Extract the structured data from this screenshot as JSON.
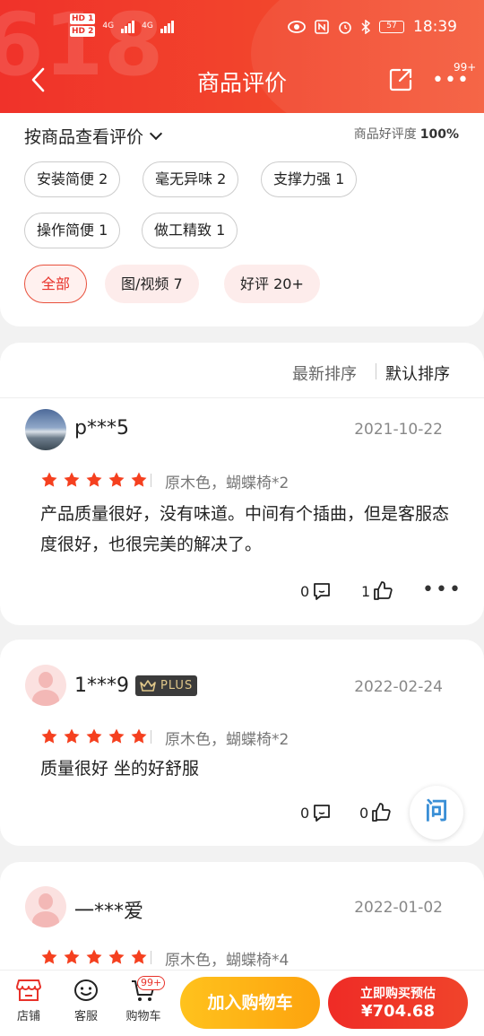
{
  "status_bar": {
    "sim1": "HD 1",
    "sim2": "HD 2",
    "net1": "4G",
    "net2": "4G",
    "battery": "57",
    "time": "18:39"
  },
  "header": {
    "background_text": "618",
    "title": "商品评价",
    "more_badge": "99+",
    "colors": {
      "primary": "#f0322a",
      "accent": "#f55b3a"
    }
  },
  "filters": {
    "by_product_label": "按商品查看评价",
    "good_rate_label": "商品好评度",
    "good_rate_value": "100%",
    "tags": [
      "安装简便 2",
      "毫无异味 2",
      "支撑力强 1",
      "操作简便 1",
      "做工精致 1"
    ],
    "categories": [
      {
        "label": "全部",
        "active": true
      },
      {
        "label": "图/视频 7",
        "active": false
      },
      {
        "label": "好评 20+",
        "active": false
      }
    ]
  },
  "sort": {
    "latest": "最新排序",
    "default": "默认排序"
  },
  "reviews": [
    {
      "user": "p***5",
      "date": "2021-10-22",
      "rating": 5,
      "spec": "原木色，蝴蝶椅*2",
      "content": "产品质量很好，没有味道。中间有个插曲，但是客服态度很好，也很完美的解决了。",
      "comments": "0",
      "likes": "1"
    },
    {
      "user": "1***9",
      "badge": "PLUS",
      "date": "2022-02-24",
      "rating": 5,
      "spec": "原木色，蝴蝶椅*2",
      "content": "质量很好 坐的好舒服",
      "comments": "0",
      "likes": "0"
    },
    {
      "user": "一***爱",
      "date": "2022-01-02",
      "rating": 5,
      "spec": "原木色，蝴蝶椅*4"
    }
  ],
  "ask_button": "问",
  "bottom_bar": {
    "store": "店铺",
    "service": "客服",
    "cart": "购物车",
    "cart_badge": "99+",
    "add_to_cart": "加入购物车",
    "buy_now": "立即购买预估",
    "price": "¥704.68"
  }
}
